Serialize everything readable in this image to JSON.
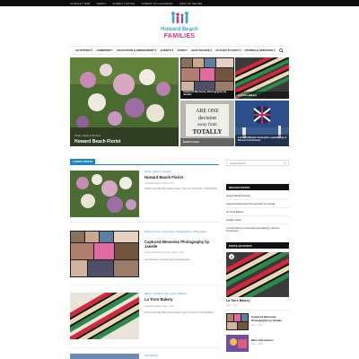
{
  "topbar": {
    "links": [
      "Contact Bob",
      "About",
      "Submit Listing",
      "Submit to Calendar",
      "Sign Up Online"
    ]
  },
  "logo": {
    "line1": "Howard Beach",
    "line2": "FAMILIES"
  },
  "nav": {
    "items": [
      "Activities ▾",
      "Community",
      "Education & Enrichment ▾",
      "Events ▾",
      "Food ▾",
      "Healthcare ▾",
      "Places to Visit ▾",
      "Stores & Services ▾"
    ]
  },
  "hero": {
    "main": {
      "crumb": "Florist  •  Stores & Services",
      "title": "Howard Beach Florist"
    },
    "tiles": [
      {
        "title": "Captured Memories Photography by Janelle"
      },
      {
        "title": "La Torre Bakery"
      },
      {
        "title": "Health Coach"
      },
      {
        "title": "Lori with Women Counselors specializing in Divorce Foreclosure"
      }
    ]
  },
  "latest": {
    "label": "LATEST POSTS"
  },
  "posts": [
    {
      "meta": "Florist  •  Stores & Services",
      "title": "Howard Beach Florist",
      "byline": "howardbeachfam  •  May 1, 2017",
      "excerpt": "159-05 Cross Bay Blvd Howard Beach, New York 11414 (Ph: 718-843-5454) ..."
    },
    {
      "meta": "Photo Services  •  Community  •  Photographers  •  Photography",
      "title": "Captured Memories Photography by Janelle",
      "byline": "Laurette Wolenberg-Thome  •  May 1, 2017",
      "excerpt": "www.facebook.com/capturedmemoriesbyjanelle"
    },
    {
      "meta": "Bakery  •  Places to Visit  •  Food  •  Bakeries",
      "title": "La Torre Bakery",
      "byline": "howardbeachfam  •  May 1, 2017",
      "excerpt": "157-10 Cross Bay Blvd Howard Beach, New York 11414 (718) 848-0000 ..."
    },
    {
      "meta": "Photography"
    }
  ],
  "sidebar": {
    "select": "Select Month",
    "recent_head": "Recent Posts",
    "recent": [
      "Howard Beach Florist",
      "Captured Memories Photography by Janelle",
      "La Torre Bakery",
      "Health Coach",
      "Lori with Women Counselors specializing in Divorce Foreclosure"
    ],
    "popular_head": "Popular Posts",
    "popular_main": {
      "title": "La Torre Bakery",
      "date": "May 1, 2017"
    },
    "popular_list": [
      {
        "title": "Captured Memories Photography by Janelle",
        "date": "May 1, 2017"
      },
      {
        "title": "Mass Adventures",
        "date": "May 1, 2017"
      }
    ]
  },
  "colors": {
    "accent": "#1f84c6",
    "brand_blue": "#3fa9c8",
    "brand_pink": "#d6337a",
    "topbar": "#0d0d0d"
  }
}
